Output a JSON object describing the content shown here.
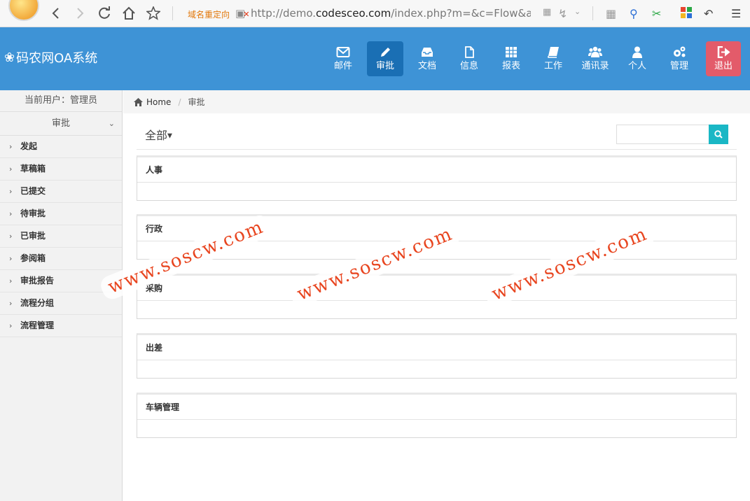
{
  "browser": {
    "redirect_label": "域名重定向",
    "url_prefix": "http://demo.",
    "url_domain": "codesceo.com",
    "url_suffix": "/index.php?m=&c=Flow&a=inde"
  },
  "header": {
    "brand": "码农网OA系统",
    "nav": [
      {
        "label": "邮件",
        "icon": "envelope-icon"
      },
      {
        "label": "审批",
        "icon": "pencil-icon",
        "active": true
      },
      {
        "label": "文档",
        "icon": "inbox-icon"
      },
      {
        "label": "信息",
        "icon": "file-icon"
      },
      {
        "label": "报表",
        "icon": "table-icon"
      },
      {
        "label": "工作",
        "icon": "book-icon"
      },
      {
        "label": "通讯录",
        "icon": "users-icon"
      },
      {
        "label": "个人",
        "icon": "user-icon"
      },
      {
        "label": "管理",
        "icon": "gears-icon"
      },
      {
        "label": "退出",
        "icon": "sign-out-icon"
      }
    ],
    "colors": {
      "bar": "#3e93d6",
      "active": "#1a6fb4",
      "exit": "#e35b6a"
    }
  },
  "sidebar": {
    "current_user": "当前用户：管理员",
    "group": "审批",
    "items": [
      {
        "label": "发起"
      },
      {
        "label": "草稿箱"
      },
      {
        "label": "已提交"
      },
      {
        "label": "待审批"
      },
      {
        "label": "已审批"
      },
      {
        "label": "参阅箱"
      },
      {
        "label": "审批报告"
      },
      {
        "label": "流程分组"
      },
      {
        "label": "流程管理"
      }
    ]
  },
  "breadcrumb": {
    "home": "Home",
    "current": "审批"
  },
  "main": {
    "filter": "全部",
    "search": {
      "placeholder": "",
      "button_color": "#1ab7c5"
    },
    "panels": [
      {
        "title": "人事"
      },
      {
        "title": "行政"
      },
      {
        "title": "采购"
      },
      {
        "title": "出差"
      },
      {
        "title": "车辆管理"
      }
    ]
  },
  "watermark": {
    "text": "www.soscw.com",
    "color": "#e8451f"
  }
}
